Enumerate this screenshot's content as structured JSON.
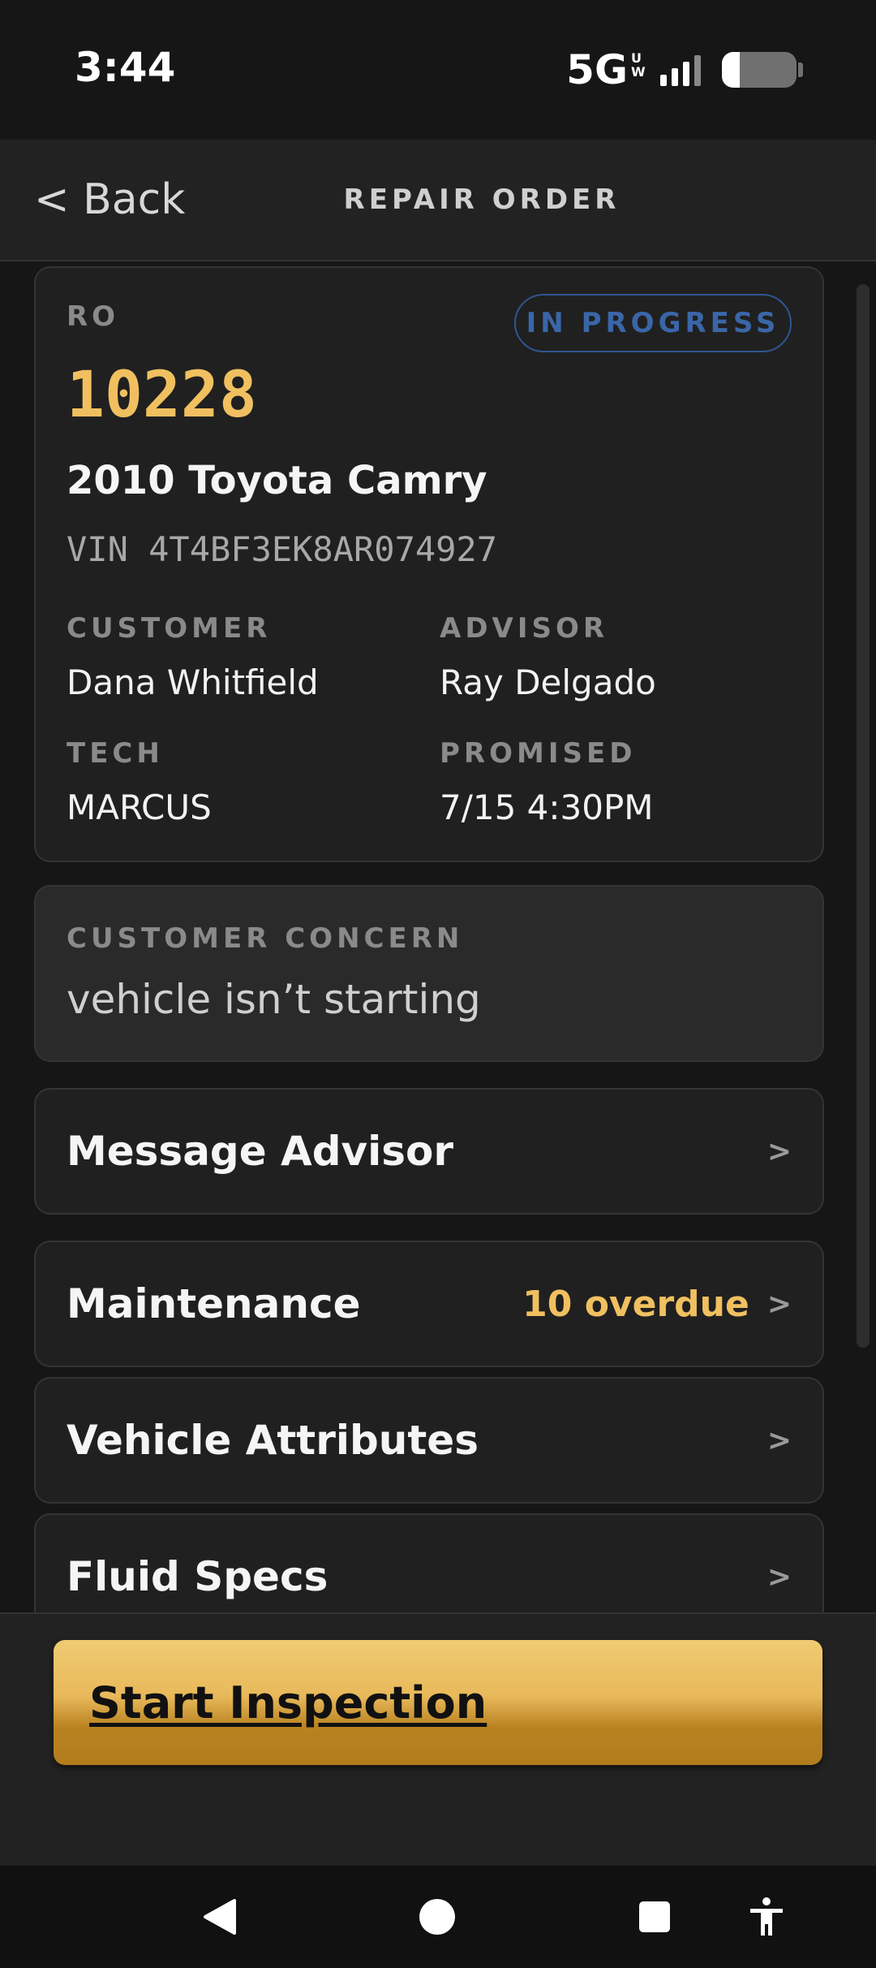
{
  "status_bar": {
    "time": "3:44",
    "network": "5G",
    "network_sub": "UW"
  },
  "header": {
    "back_label": "< Back",
    "title": "REPAIR ORDER"
  },
  "repair_order": {
    "ro_label": "RO",
    "status": "IN PROGRESS",
    "number": "10228",
    "vehicle": "2010 Toyota Camry",
    "vin": "VIN 4T4BF3EK8AR074927",
    "customer_label": "CUSTOMER",
    "customer": "Dana Whitfield",
    "advisor_label": "ADVISOR",
    "advisor": "Ray Delgado",
    "tech_label": "TECH",
    "tech": "MARCUS",
    "promised_label": "PROMISED",
    "promised": "7/15 4:30PM"
  },
  "concern": {
    "label": "CUSTOMER CONCERN",
    "text": "vehicle isn’t starting"
  },
  "rows": [
    {
      "title": "Message Advisor",
      "extra": "",
      "chevron": ">"
    },
    {
      "title": "Maintenance",
      "extra": "10 overdue",
      "chevron": ">"
    },
    {
      "title": "Vehicle Attributes",
      "extra": "",
      "chevron": ">"
    },
    {
      "title": "Fluid Specs",
      "extra": "",
      "chevron": ">"
    }
  ],
  "primary_action": {
    "label": "Start Inspection"
  },
  "colors": {
    "accent": "#f0c060",
    "status_blue": "#3a66a8",
    "background": "#161616",
    "card": "#202020"
  },
  "icons": {
    "nav_back": "triangle-back-icon",
    "nav_home": "circle-home-icon",
    "nav_recent": "square-recents-icon",
    "accessibility": "accessibility-icon"
  }
}
